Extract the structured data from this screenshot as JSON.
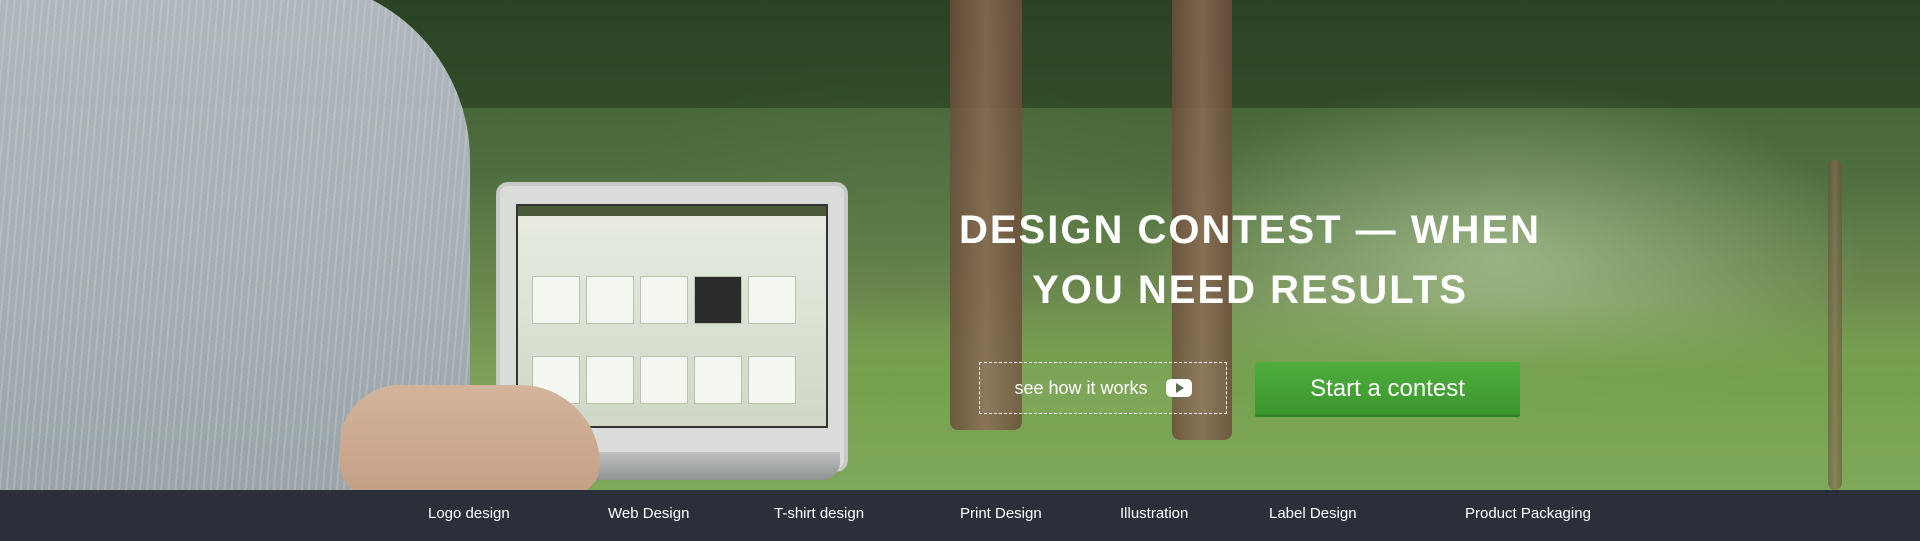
{
  "hero": {
    "headline_line1": "DESIGN CONTEST — WHEN",
    "headline_line2": "YOU NEED RESULTS",
    "see_how_label": "see how it works",
    "start_label": "Start a contest"
  },
  "colors": {
    "accent_green": "#45a336",
    "nav_background": "#2b2f3a",
    "text": "#ffffff"
  },
  "icons": {
    "video": "youtube-play-icon"
  },
  "nav": {
    "items": [
      {
        "label": "Logo design"
      },
      {
        "label": "Web Design"
      },
      {
        "label": "T-shirt design"
      },
      {
        "label": "Print Design"
      },
      {
        "label": "Illustration"
      },
      {
        "label": "Label Design"
      },
      {
        "label": "Product Packaging"
      }
    ]
  }
}
